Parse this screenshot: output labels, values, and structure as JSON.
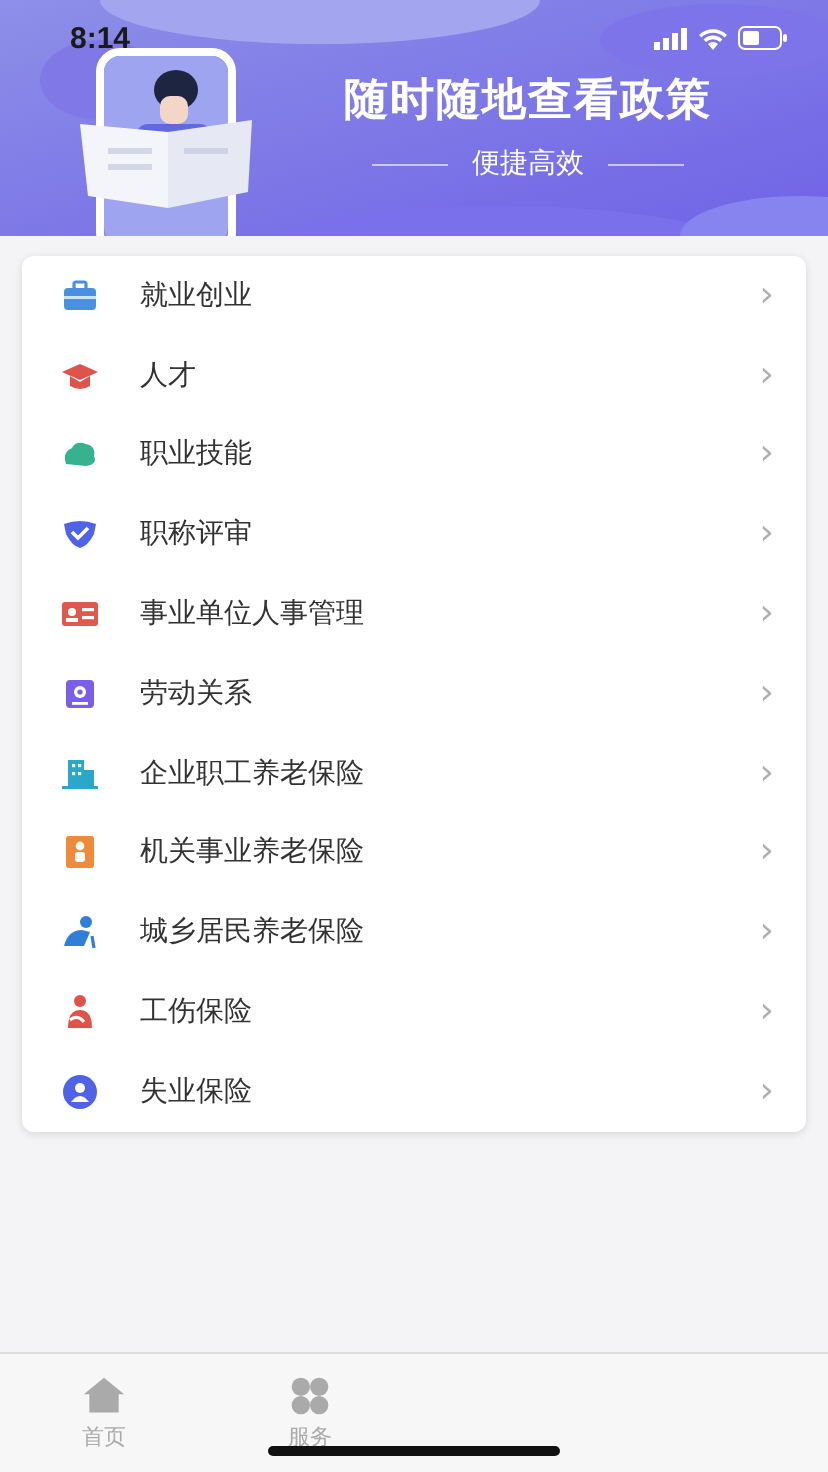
{
  "status_bar": {
    "time": "8:14"
  },
  "banner": {
    "title": "随时随地查看政策",
    "subtitle": "便捷高效"
  },
  "menu": [
    {
      "label": "就业创业",
      "chevron": "›"
    },
    {
      "label": "人才",
      "chevron": "›"
    },
    {
      "label": "职业技能",
      "chevron": "›"
    },
    {
      "label": "职称评审",
      "chevron": "›"
    },
    {
      "label": "事业单位人事管理",
      "chevron": "›"
    },
    {
      "label": "劳动关系",
      "chevron": "›"
    },
    {
      "label": "企业职工养老保险",
      "chevron": "›"
    },
    {
      "label": "机关事业养老保险",
      "chevron": "›"
    },
    {
      "label": "城乡居民养老保险",
      "chevron": "›"
    },
    {
      "label": "工伤保险",
      "chevron": "›"
    },
    {
      "label": "失业保险",
      "chevron": "›"
    }
  ],
  "tab_bar": [
    {
      "label": "首页",
      "selected": false
    },
    {
      "label": "服务",
      "selected": false
    }
  ]
}
